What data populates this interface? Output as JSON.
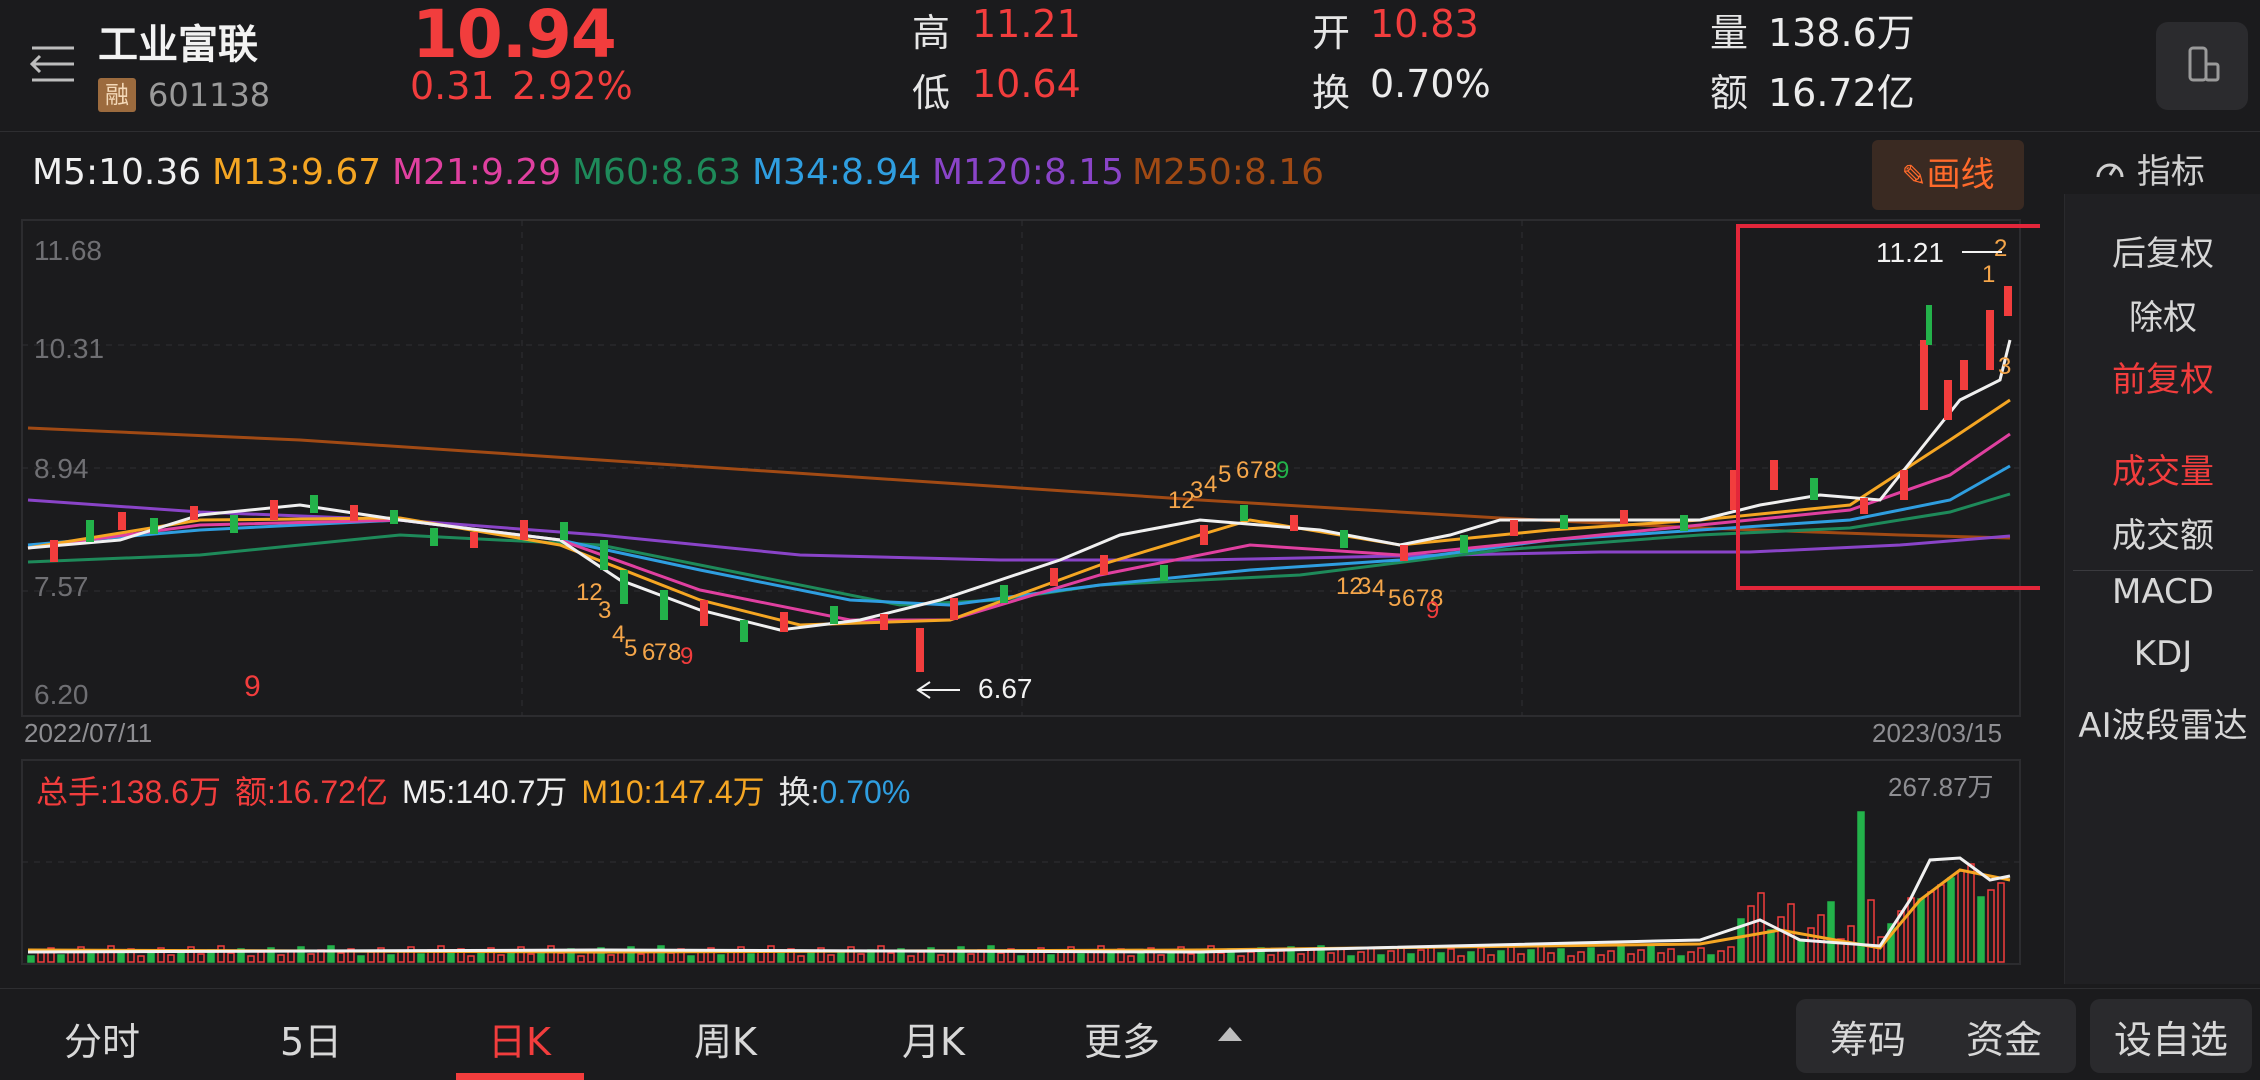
{
  "header": {
    "stock_name": "工业富联",
    "margin_badge": "融",
    "stock_code": "601138",
    "price": "10.94",
    "change": "0.31",
    "change_pct": "2.92%",
    "high_label": "高",
    "high": "11.21",
    "low_label": "低",
    "low": "10.64",
    "open_label": "开",
    "open": "10.83",
    "turnover_label": "换",
    "turnover": "0.70%",
    "volume_label": "量",
    "volume": "138.6万",
    "amount_label": "额",
    "amount": "16.72亿"
  },
  "ma_legend": [
    {
      "text": "M5:10.36",
      "color": "#f0f0f0"
    },
    {
      "text": "M13:9.67",
      "color": "#f5a623"
    },
    {
      "text": "M21:9.29",
      "color": "#e040a0"
    },
    {
      "text": "M60:8.63",
      "color": "#1e8a5a"
    },
    {
      "text": "M34:8.94",
      "color": "#2f9ee0"
    },
    {
      "text": "M120:8.15",
      "color": "#8a44c8"
    },
    {
      "text": "M250:8.16",
      "color": "#a14a14"
    }
  ],
  "draw_button": "画线",
  "right_panel": {
    "title": "指标",
    "items": [
      "后复权",
      "除权",
      "前复权",
      "成交量",
      "成交额",
      "MACD",
      "KDJ",
      "AI波段雷达"
    ],
    "active_items": [
      "前复权",
      "成交量"
    ]
  },
  "chart": {
    "y_ticks": [
      "11.68",
      "10.31",
      "8.94",
      "7.57",
      "6.20"
    ],
    "start_date": "2022/07/11",
    "end_date": "2023/03/15",
    "high_marker": "11.21",
    "low_marker": "6.67",
    "nine_marker": "9",
    "volume_legend": {
      "total": "总手:138.6万",
      "amount": "额:16.72亿",
      "m5": "M5:140.7万",
      "m10": "M10:147.4万",
      "turnover_label": "换:",
      "turnover_value": "0.70%"
    },
    "volume_max": "267.87万"
  },
  "chart_data": {
    "type": "candlestick",
    "symbol": "601138",
    "x_range": [
      "2022/07/11",
      "2023/03/15"
    ],
    "ylim": [
      6.2,
      11.68
    ],
    "y_ticks": [
      11.68,
      10.31,
      8.94,
      7.57,
      6.2
    ],
    "period_high": 11.21,
    "period_low": 6.67,
    "last_close": 10.94,
    "moving_averages": [
      {
        "name": "M5",
        "value": 10.36
      },
      {
        "name": "M13",
        "value": 9.67
      },
      {
        "name": "M21",
        "value": 9.29
      },
      {
        "name": "M60",
        "value": 8.63
      },
      {
        "name": "M34",
        "value": 8.94
      },
      {
        "name": "M120",
        "value": 8.15
      },
      {
        "name": "M250",
        "value": 8.16
      }
    ],
    "volume": {
      "latest": "138.6万",
      "m5": "140.7万",
      "m10": "147.4万",
      "max": "267.87万"
    }
  },
  "bottom_tabs": [
    "分时",
    "5日",
    "日K",
    "周K",
    "月K",
    "更多"
  ],
  "active_tab": "日K",
  "bottom_buttons": [
    "筹码",
    "资金",
    "设自选"
  ]
}
